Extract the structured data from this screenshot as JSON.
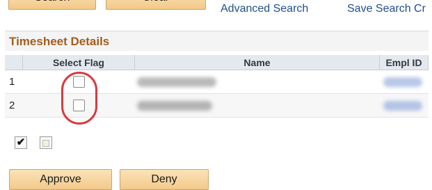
{
  "toolbar": {
    "search_label": "Search",
    "clear_label": "Clear",
    "advanced_search_label": "Advanced Search",
    "save_search_label": "Save Search Cr"
  },
  "panel": {
    "title": "Timesheet Details"
  },
  "grid": {
    "headers": {
      "select_flag": "Select Flag",
      "name": "Name",
      "empl_id": "Empl ID"
    },
    "rows": [
      {
        "num": "1"
      },
      {
        "num": "2"
      }
    ]
  },
  "actions": {
    "approve_label": "Approve",
    "deny_label": "Deny"
  },
  "select_all": {
    "check_glyph": "✔"
  },
  "colors": {
    "accent_red": "#d8393f",
    "panel_title": "#a35d1c",
    "link": "#1f4e8c"
  }
}
